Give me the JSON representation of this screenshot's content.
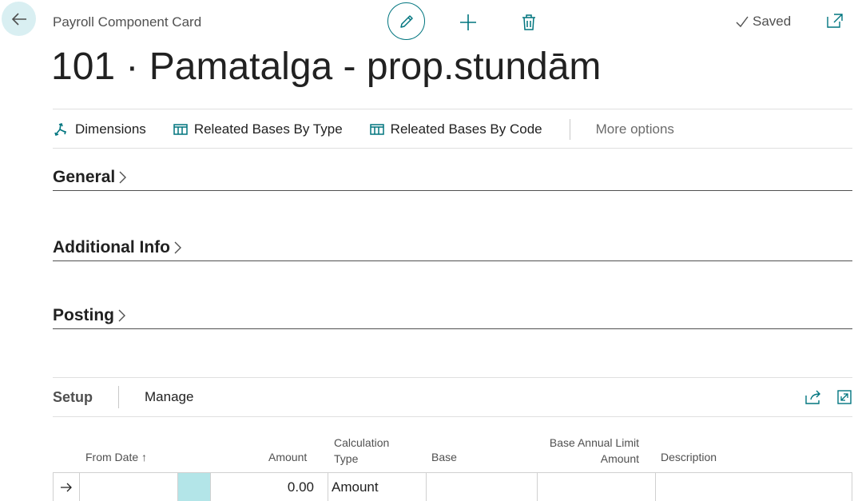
{
  "header": {
    "breadcrumb": "Payroll Component Card",
    "title": "101 · Pamatalga - prop.stundām",
    "status": "Saved"
  },
  "actions": {
    "dimensions": "Dimensions",
    "bases_by_type": "Releated Bases By Type",
    "bases_by_code": "Releated Bases By Code",
    "more": "More options"
  },
  "sections": {
    "general": "General",
    "additional": "Additional Info",
    "posting": "Posting"
  },
  "subpage": {
    "tab_setup": "Setup",
    "tab_manage": "Manage",
    "columns": {
      "from_date": "From Date",
      "sort_indicator": "↑",
      "amount": "Amount",
      "calc_type_1": "Calculation",
      "calc_type_2": "Type",
      "base": "Base",
      "base_limit_1": "Base Annual Limit",
      "base_limit_2": "Amount",
      "description": "Description"
    },
    "rows": [
      {
        "from_date": "",
        "amount": "0.00",
        "calculation_type": "Amount",
        "base": "",
        "base_limit": "",
        "description": ""
      }
    ]
  },
  "colors": {
    "accent": "#00757f",
    "back_bg": "#d9eff2",
    "selected_cell": "#b3e5e8"
  },
  "icons": [
    "back-arrow-icon",
    "pencil-icon",
    "plus-icon",
    "trash-icon",
    "checkmark-icon",
    "popout-icon",
    "dimensions-icon",
    "table-icon",
    "chevron-right-icon",
    "share-icon",
    "expand-icon",
    "row-arrow-icon"
  ]
}
